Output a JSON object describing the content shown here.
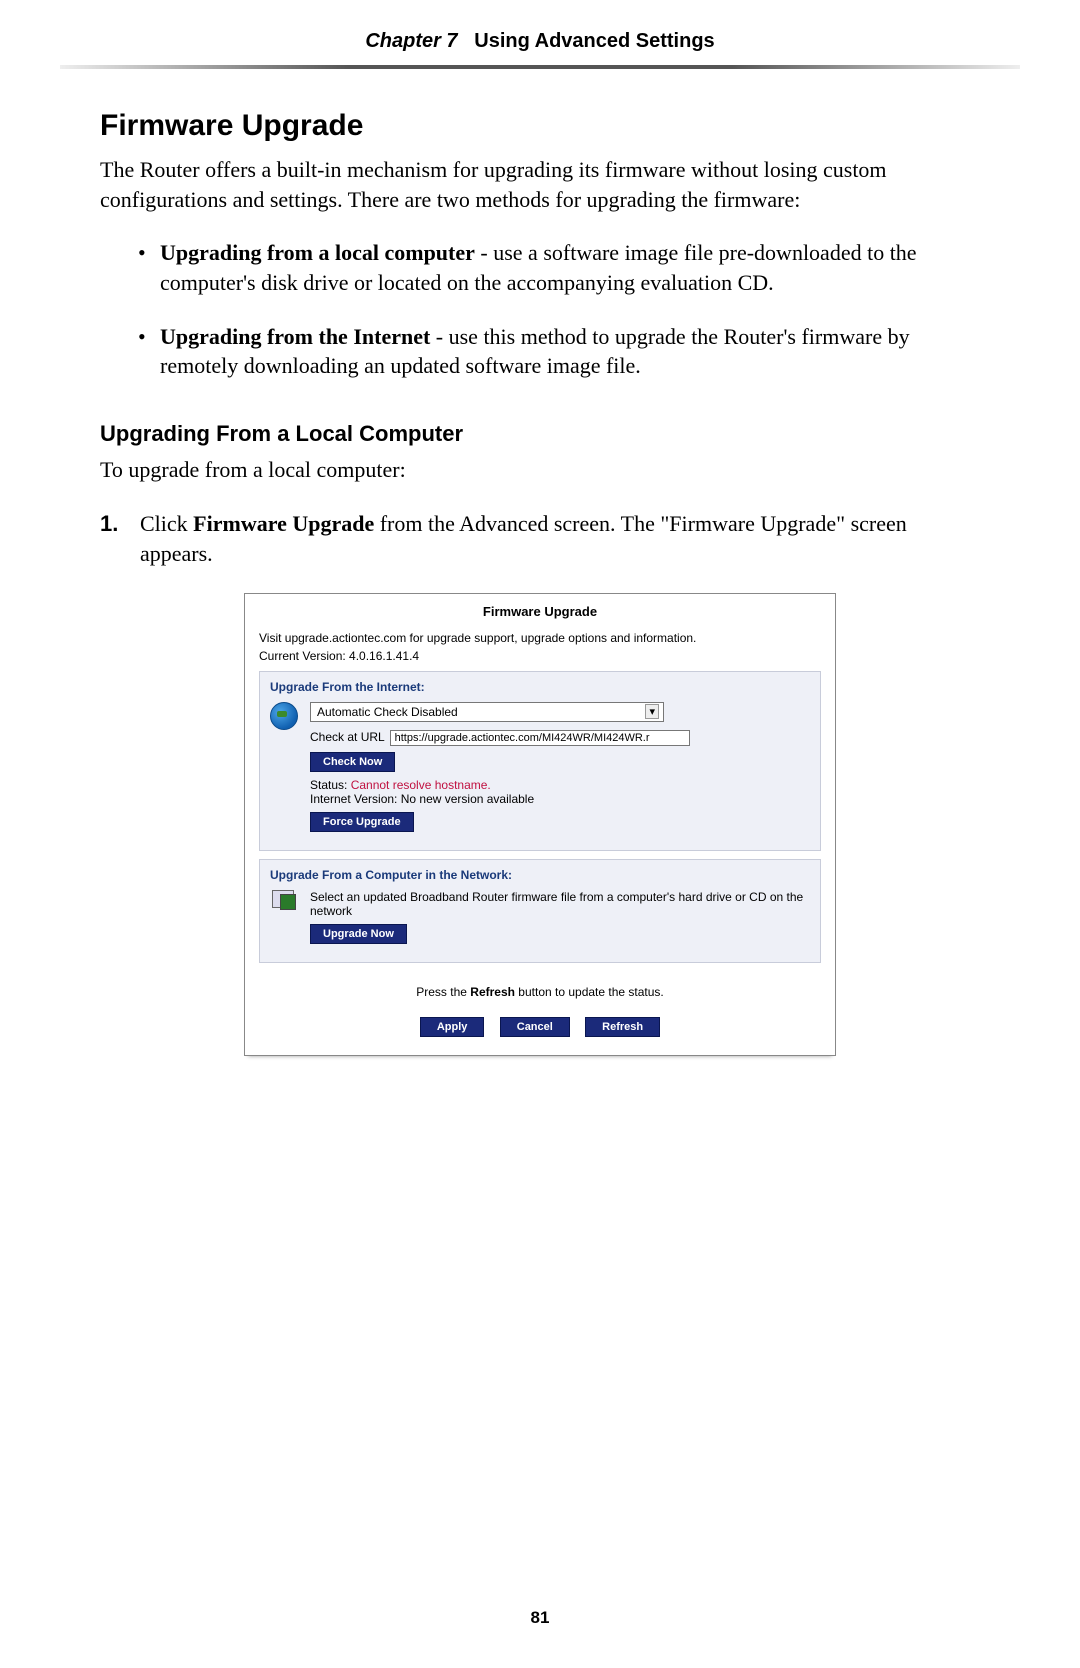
{
  "header": {
    "chapter": "Chapter 7",
    "title": "Using Advanced Settings"
  },
  "section": {
    "heading": "Firmware Upgrade",
    "intro": "The Router offers a built-in mechanism for upgrading its firmware without losing custom configurations and settings. There are two methods for upgrading the firmware:",
    "bullets": [
      {
        "label": "Upgrading from a local computer",
        "text": " - use a software image file pre-downloaded to the computer's disk drive or located on the accompanying evaluation CD."
      },
      {
        "label": "Upgrading from the Internet",
        "text": " - use this method to upgrade the Router's firmware by remotely downloading an updated software image file."
      }
    ]
  },
  "subsection": {
    "heading": "Upgrading From a Local Computer",
    "intro": "To upgrade from a local computer:",
    "step_num": "1.",
    "step_prefix": "Click ",
    "step_bold": "Firmware Upgrade",
    "step_suffix": " from the Advanced screen. The \"Firmware Upgrade\" screen appears."
  },
  "panel": {
    "title": "Firmware Upgrade",
    "visit_line": "Visit upgrade.actiontec.com for upgrade support, upgrade options and information.",
    "current_version_line": "Current Version: 4.0.16.1.41.4",
    "internet": {
      "title": "Upgrade From the Internet:",
      "dropdown": "Automatic Check Disabled",
      "check_label": "Check at URL",
      "check_url": "https://upgrade.actiontec.com/MI424WR/MI424WR.r",
      "check_now_btn": "Check Now",
      "status_label": "Status: ",
      "status_value": "Cannot resolve hostname.",
      "internet_version": "Internet Version: No new version available",
      "force_btn": "Force Upgrade"
    },
    "local": {
      "title": "Upgrade From a Computer in the Network:",
      "desc": "Select an updated Broadband Router firmware file from a computer's hard drive or CD on the network",
      "upgrade_btn": "Upgrade Now"
    },
    "footer": {
      "text_prefix": "Press the ",
      "text_bold": "Refresh",
      "text_suffix": " button to update the status.",
      "apply": "Apply",
      "cancel": "Cancel",
      "refresh": "Refresh"
    }
  },
  "page_number": "81"
}
